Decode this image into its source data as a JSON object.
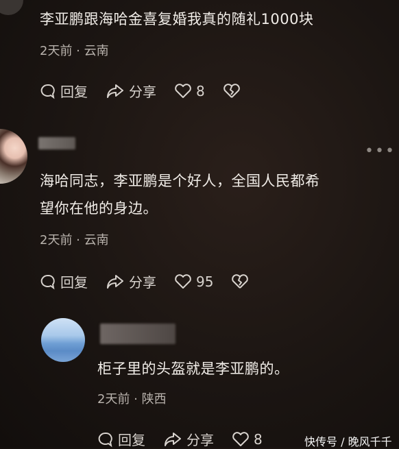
{
  "comments": [
    {
      "text": "李亚鹏跟海哈金喜复婚我真的随礼1000块",
      "meta": "2天前 · 云南",
      "reply_label": "回复",
      "share_label": "分享",
      "likes": "8"
    },
    {
      "text_line1": "海哈同志，李亚鹏是个好人，全国人民都希",
      "text_line2": "望你在他的身边。",
      "meta": "2天前 · 云南",
      "reply_label": "回复",
      "share_label": "分享",
      "likes": "95",
      "more": "•••"
    },
    {
      "text": "柜子里的头盔就是李亚鹏的。",
      "meta": "2天前 · 陕西",
      "reply_label": "回复",
      "share_label": "分享",
      "likes": "8"
    }
  ],
  "watermark": "快传号 / 晚风千千",
  "colors": {
    "background": "#1b1512",
    "text": "#f1ede8",
    "meta": "#b9b3ad"
  }
}
